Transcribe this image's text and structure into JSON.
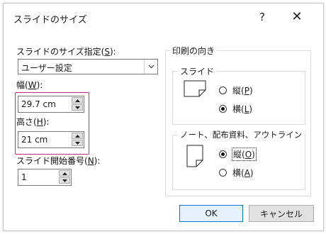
{
  "dialog": {
    "title": "スライドのサイズ",
    "help_glyph": "?",
    "close_glyph": "✕"
  },
  "size": {
    "label_prefix": "スライドのサイズ指定(",
    "label_key": "S",
    "label_suffix": "):",
    "value": "ユーザー設定"
  },
  "width": {
    "label_prefix": "幅(",
    "label_key": "W",
    "label_suffix": "):",
    "value": "29.7 cm"
  },
  "height": {
    "label_prefix": "高さ(",
    "label_key": "H",
    "label_suffix": "):",
    "value": "21 cm"
  },
  "start_number": {
    "label_prefix": "スライド開始番号(",
    "label_key": "N",
    "label_suffix": "):",
    "value": "1"
  },
  "orientation": {
    "title": "印刷の向き",
    "slides": {
      "title": "スライド",
      "options": [
        {
          "prefix": "縦(",
          "key": "P",
          "suffix": ")",
          "selected": false
        },
        {
          "prefix": "横(",
          "key": "L",
          "suffix": ")",
          "selected": true
        }
      ]
    },
    "notes": {
      "title": "ノート、配布資料、アウトライン",
      "options": [
        {
          "prefix": "縦(",
          "key": "O",
          "suffix": ")",
          "selected": true
        },
        {
          "prefix": "横(",
          "key": "A",
          "suffix": ")",
          "selected": false
        }
      ]
    }
  },
  "buttons": {
    "ok": "OK",
    "cancel": "キャンセル"
  },
  "colors": {
    "highlight": "#c02a8c",
    "accent": "#0078d7"
  }
}
